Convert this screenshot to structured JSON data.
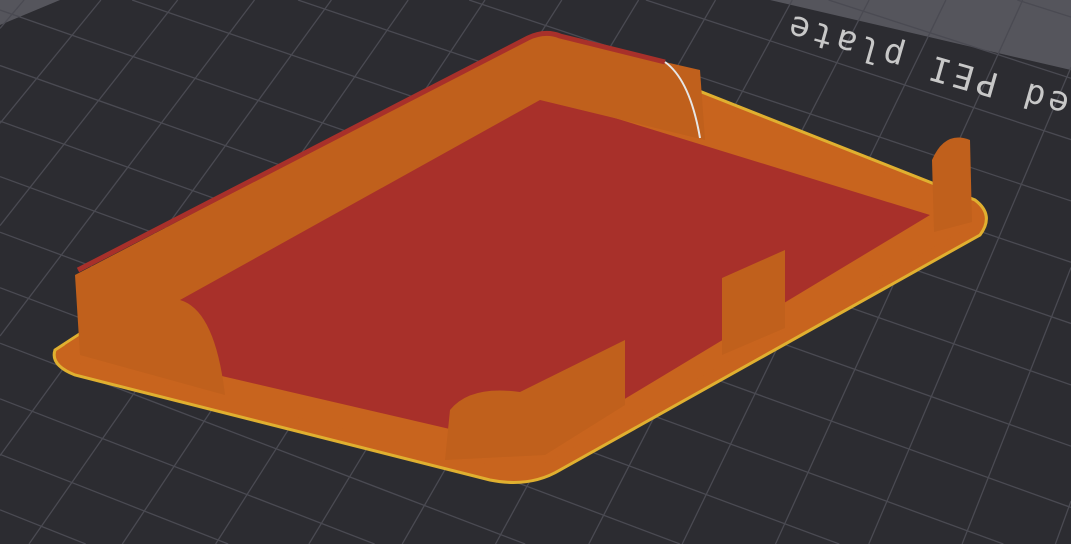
{
  "viewport": {
    "bed_label": "ed PEI plate",
    "colors": {
      "background": "#2c2c31",
      "off_bed": "#55555c",
      "grid": "#4a4a52",
      "wall": "#c8641e",
      "infill": "#a8302a",
      "skirt": "#e0b030"
    }
  }
}
